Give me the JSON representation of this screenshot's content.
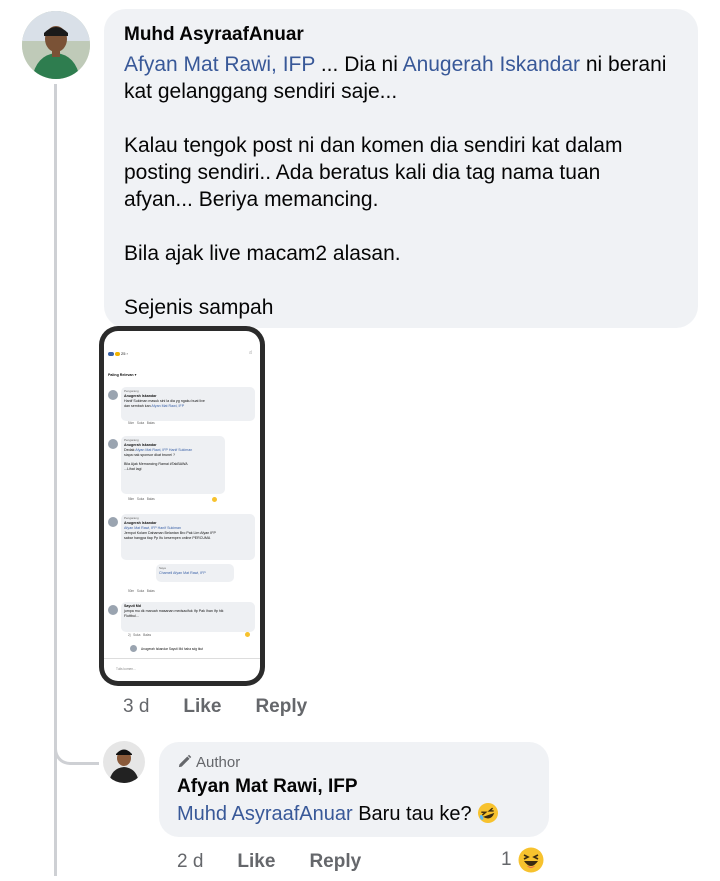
{
  "comment1": {
    "author": "Muhd AsyraafAnuar",
    "line1_link_a": "Afyan Mat Rawi, IFP",
    "line1_text_a": " ... Dia ni ",
    "line1_link_b": "Anugerah Iskandar",
    "line1_text_b": " ni berani",
    "line2": "kat gelanggang sendiri saje...",
    "para2_l1": "Kalau tengok post ni dan komen dia sendiri kat dalam",
    "para2_l2": "posting sendiri.. Ada beratus kali dia tag nama tuan",
    "para2_l3": "afyan... Beriya memancing.",
    "para3": "Bila ajak live macam2 alasan.",
    "para4": "Sejenis sampah",
    "time": "3 d",
    "like": "Like",
    "reply": "Reply"
  },
  "attachment": {
    "status_left": "25",
    "sort_label": "Paling Relevan",
    "c1_badge": "Pengarang",
    "c1_name": "Anugerah Iskandar",
    "c1_l1": "Hanif Sukiman  masuk sini la dia yg ngaku buat live",
    "c1_l2": "dan sembah kan ",
    "c1_link": "Afyan Mat Rawi, IFP",
    "c1_time": "54m",
    "c2_badge": "Pengarang",
    "c2_name": "Anugerah Iskandar",
    "c2_l1a": "Dedak ",
    "c2_l1link": "Afyan Mat Rawi, IFP Hanif Sukiman",
    "c2_l2": "siapa nak sponsor dkat brunei ?",
    "c2_l3": "Bila Ajak Memancing Ramai #TakBAWA",
    "c2_l4": "...Lihat lagi",
    "c2_time": "56m",
    "c3_badge": "Pengarang",
    "c3_name": "Anugerah Iskandar",
    "c3_l1": "Afyan Mat Rawi, IFP Hanif Sukiman",
    "c3_l2": "Jemput Kolam Dahaman Belantan Bro Pak Lim Afyan IFP",
    "c3_l3": "sabar hangpa tiap Pp Ifu kesempen online PERCUMA",
    "c3_reply": "Chamell Afyan Mat Rawi, IFP",
    "c3_time": "50m",
    "c4_name": "Sayuti Md",
    "c4_l1": "jumpa mu dk maruah masanan medsacifuk Ifp Pak Ihan Ifp hik",
    "c4_l2": "Fluttbul...",
    "c4_time": "2j",
    "c5_text": "Anugerah Iskandar Sayuti Md haha sdg tkut",
    "input_placeholder": "Tulis komen..."
  },
  "reply1": {
    "badge": "Author",
    "author": "Afyan Mat Rawi, IFP",
    "mention": "Muhd AsyraafAnuar",
    "text": " Baru tau ke? ",
    "time": "2 d",
    "like": "Like",
    "reply": "Reply",
    "reaction_count": "1"
  }
}
